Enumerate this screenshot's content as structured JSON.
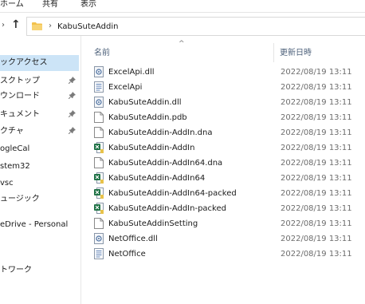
{
  "ribbon": {
    "tabs": [
      "ホーム",
      "共有",
      "表示"
    ]
  },
  "address": {
    "path": "KabuSuteAddin"
  },
  "sidebar": {
    "items": [
      {
        "label": "ックアクセス",
        "pinned": false,
        "selected": true
      },
      {
        "label": "スクトップ",
        "pinned": true,
        "selected": false
      },
      {
        "label": "ウンロード",
        "pinned": true,
        "selected": false
      },
      {
        "label": "キュメント",
        "pinned": true,
        "selected": false
      },
      {
        "label": "クチャ",
        "pinned": true,
        "selected": false
      },
      {
        "label": "ogleCal",
        "pinned": false,
        "selected": false
      },
      {
        "label": "stem32",
        "pinned": false,
        "selected": false
      },
      {
        "label": "vsc",
        "pinned": false,
        "selected": false
      },
      {
        "label": "ュージック",
        "pinned": false,
        "selected": false
      },
      {
        "label": "eDrive - Personal",
        "pinned": false,
        "selected": false
      },
      {
        "label": "トワーク",
        "pinned": false,
        "selected": false
      }
    ]
  },
  "columns": {
    "name": "名前",
    "date": "更新日時"
  },
  "files": [
    {
      "name": "ExcelApi.dll",
      "date": "2022/08/19 13:11",
      "icon": "dll-icon"
    },
    {
      "name": "ExcelApi",
      "date": "2022/08/19 13:11",
      "icon": "xml-document-icon"
    },
    {
      "name": "KabuSuteAddin.dll",
      "date": "2022/08/19 13:11",
      "icon": "dll-icon"
    },
    {
      "name": "KabuSuteAddin.pdb",
      "date": "2022/08/19 13:11",
      "icon": "blank-file-icon"
    },
    {
      "name": "KabuSuteAddin-AddIn.dna",
      "date": "2022/08/19 13:11",
      "icon": "blank-file-icon"
    },
    {
      "name": "KabuSuteAddin-AddIn",
      "date": "2022/08/19 13:11",
      "icon": "excel-addin-icon"
    },
    {
      "name": "KabuSuteAddin-AddIn64.dna",
      "date": "2022/08/19 13:11",
      "icon": "blank-file-icon"
    },
    {
      "name": "KabuSuteAddin-AddIn64",
      "date": "2022/08/19 13:11",
      "icon": "excel-addin-icon"
    },
    {
      "name": "KabuSuteAddin-AddIn64-packed",
      "date": "2022/08/19 13:11",
      "icon": "excel-addin-icon"
    },
    {
      "name": "KabuSuteAddin-AddIn-packed",
      "date": "2022/08/19 13:11",
      "icon": "excel-addin-icon"
    },
    {
      "name": "KabuSuteAddinSetting",
      "date": "2022/08/19 13:11",
      "icon": "blank-file-icon"
    },
    {
      "name": "NetOffice.dll",
      "date": "2022/08/19 13:11",
      "icon": "dll-icon"
    },
    {
      "name": "NetOffice",
      "date": "2022/08/19 13:11",
      "icon": "xml-document-icon"
    }
  ],
  "colors": {
    "selection": "#cce4f7",
    "folder": "#f3c14b",
    "excel": "#1e7145",
    "header_text": "#4c607a"
  }
}
